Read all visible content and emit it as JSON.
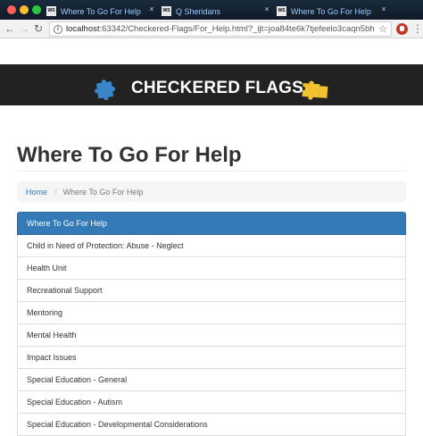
{
  "browser": {
    "tabs": [
      {
        "title": "Where To Go For Help",
        "icon": "webstorm-icon"
      },
      {
        "title": "Q Sheridans",
        "icon": "webstorm-icon"
      },
      {
        "title": "Where To Go For Help",
        "icon": "webstorm-icon"
      }
    ],
    "url_host": "localhost",
    "url_rest": ":63342/Checkered-Flags/For_Help.html?_ijt=joa84te6k7tjefeelo3caqn5bh"
  },
  "header": {
    "brand": "CHECKERED FLAGS",
    "background": "#222222",
    "left_puzzle_color": "#3a86c8",
    "right_puzzle_color": "#f2c230"
  },
  "main": {
    "title": "Where To Go For Help",
    "breadcrumb": {
      "home": "Home",
      "separator": "/",
      "current": "Where To Go For Help"
    },
    "panel": {
      "heading": "Where To Go For Help",
      "accent": "#337ab7",
      "items": [
        "Child in Need of Protection: Abuse - Neglect",
        "Health Unit",
        "Recreational Support",
        "Mentoring",
        "Mental Health",
        "Impact Issues",
        "Special Education - General",
        "Special Education - Autism",
        "Special Education - Developmental Considerations"
      ]
    }
  }
}
